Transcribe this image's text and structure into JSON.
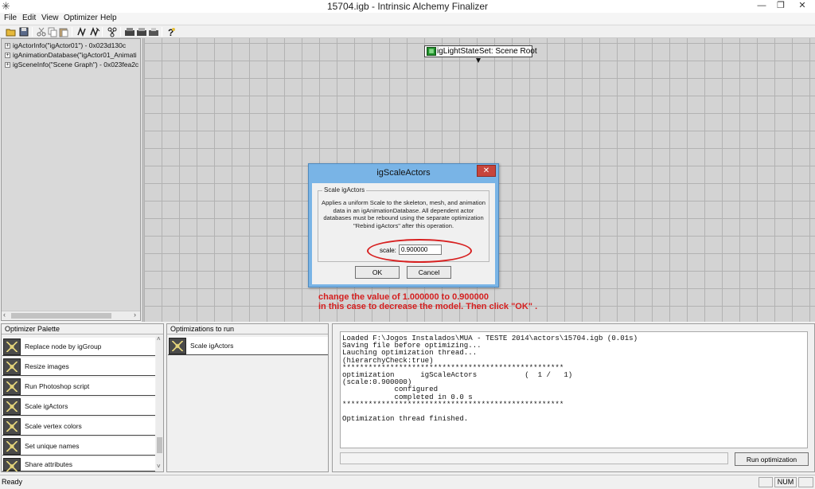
{
  "window": {
    "title": "15704.igb - Intrinsic Alchemy Finalizer",
    "minimize_glyph": "—",
    "maximize_glyph": "❐",
    "close_glyph": "✕"
  },
  "menu": {
    "items": [
      "File",
      "Edit",
      "View",
      "Optimizer",
      "Help"
    ]
  },
  "toolbar": {
    "buttons": [
      "open-icon",
      "save-icon",
      "cut-icon",
      "copy-icon",
      "paste-icon",
      "link-icon",
      "unlink-icon",
      "group-icon",
      "export-icon",
      "import-icon",
      "render-icon",
      "help-icon"
    ]
  },
  "tree": {
    "items": [
      {
        "label": "igActorInfo(\"igActor01\") - 0x023d130c"
      },
      {
        "label": "igAnimationDatabase(\"igActor01_Animati"
      },
      {
        "label": "igSceneInfo(\"Scene Graph\") - 0x023fea2c"
      }
    ]
  },
  "scene": {
    "node_label": "igLightStateSet: Scene Root"
  },
  "dialog": {
    "title": "igScaleActors",
    "group_label": "Scale igActors",
    "description": "Applies a uniform Scale to the skeleton, mesh, and animation data in an igAnimationDatabase. All dependent actor databases must be rebound using the separate optimization \"Rebind igActors\" after this operation.",
    "scale_label": "scale:",
    "scale_value": "0.900000",
    "ok_label": "OK",
    "cancel_label": "Cancel"
  },
  "annotation": {
    "line1": "change the value of 1.000000 to 0.900000",
    "line2": "in this case to decrease the model. Then click \"OK\" ."
  },
  "palette": {
    "header": "Optimizer Palette",
    "items": [
      "Replace node by igGroup",
      "Resize images",
      "Run Photoshop script",
      "Scale igActors",
      "Scale vertex colors",
      "Set unique names",
      "Share attributes"
    ]
  },
  "run_list": {
    "header": "Optimizations to run",
    "items": [
      "Scale igActors"
    ]
  },
  "log": {
    "lines": [
      "Loaded F:\\Jogos Instalados\\MUA - TESTE 2014\\actors\\15704.igb (0.01s)",
      "Saving file before optimizing...",
      "Lauching optimization thread...",
      "(hierarchyCheck:true)",
      "***************************************************",
      "optimization      igScaleActors           (  1 /   1)",
      "(scale:0.900000)",
      "            configured",
      "            completed in 0.0 s",
      "***************************************************",
      "",
      "Optimization thread finished."
    ]
  },
  "run_button": {
    "label": "Run optimization"
  },
  "status": {
    "text": "Ready",
    "num": "NUM"
  },
  "colors": {
    "annotation_red": "#d41f1f",
    "dialog_frame": "#79b4e6",
    "close_red": "#c7453c",
    "node_green": "#1f8f2a"
  }
}
